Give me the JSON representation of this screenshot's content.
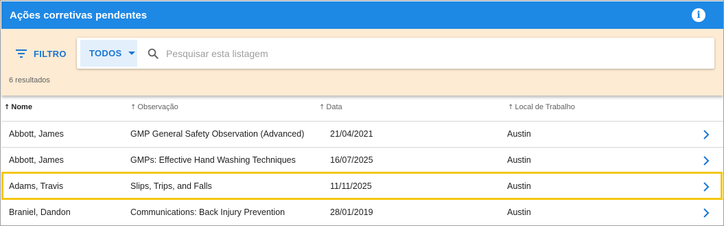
{
  "header": {
    "title": "Ações corretivas pendentes",
    "info_icon": "info-icon"
  },
  "filter": {
    "label": "FILTRO",
    "icon": "filter-icon"
  },
  "search": {
    "scope_label": "TODOS",
    "placeholder": "Pesquisar esta listagem",
    "value": ""
  },
  "results_count": "6 resultados",
  "table": {
    "columns": [
      "Nome",
      "Observação",
      "Data",
      "Local de Trabalho"
    ],
    "rows": [
      {
        "name": "Abbott, James",
        "observation": "GMP General Safety Observation (Advanced)",
        "date": "21/04/2021",
        "location": "Austin"
      },
      {
        "name": "Abbott, James",
        "observation": "GMPs: Effective Hand Washing Techniques",
        "date": "16/07/2025",
        "location": "Austin"
      },
      {
        "name": "Adams, Travis",
        "observation": "Slips, Trips, and Falls",
        "date": "11/11/2025",
        "location": "Austin"
      },
      {
        "name": "Braniel, Dandon",
        "observation": "Communications: Back Injury Prevention",
        "date": "28/01/2019",
        "location": "Austin"
      }
    ]
  },
  "colors": {
    "header_bg": "#1e88e5",
    "filter_bg": "#fdebd3",
    "accent": "#1976d2",
    "highlight": "#f4c70f"
  }
}
